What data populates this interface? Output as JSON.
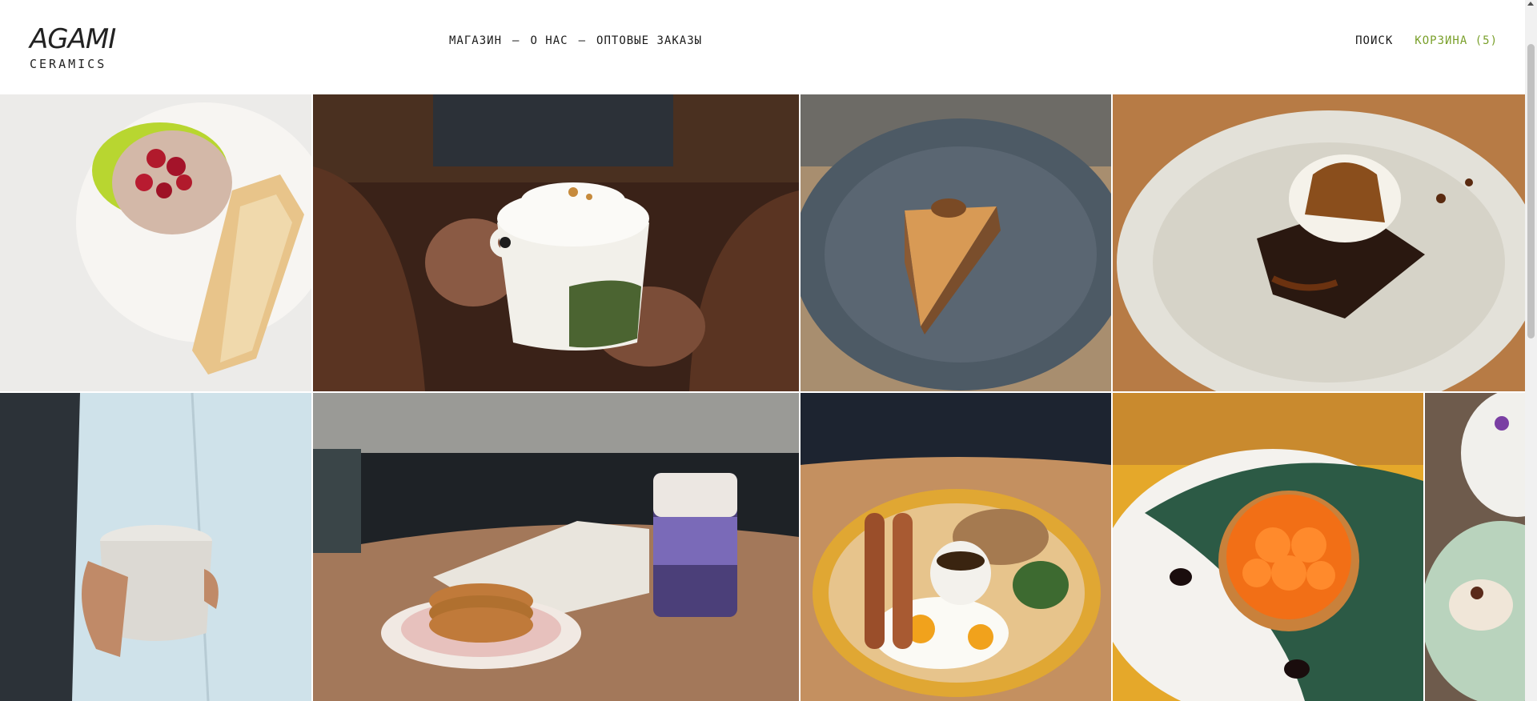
{
  "header": {
    "logo": {
      "mark": "AGAMI",
      "sub": "CERAMICS"
    },
    "nav": [
      {
        "label": "МАГАЗИН"
      },
      {
        "label": "О НАС"
      },
      {
        "label": "ОПТОВЫЕ ЗАКАЗЫ"
      }
    ],
    "separator": "—",
    "search_label": "ПОИСК",
    "cart_label": "КОРЗИНА (5)"
  },
  "gallery": {
    "tiles": [
      {
        "subject": "plate with cream dip, cherries and toast"
      },
      {
        "subject": "hands holding mug with whipped cream"
      },
      {
        "subject": "cheesecake slice with pecans on grey plate"
      },
      {
        "subject": "brownie with ice cream and caramel on white plate"
      },
      {
        "subject": "hand holding speckled cup"
      },
      {
        "subject": "cookies on pink plate with purple latte and magazine"
      },
      {
        "subject": "breakfast plate with eggs and sausages"
      },
      {
        "subject": "apricot tart on green and white plate"
      },
      {
        "subject": "dessert on mint speckled plate"
      }
    ]
  },
  "colors": {
    "accent_cart": "#7aa02b",
    "text": "#1a1a1a",
    "background": "#ffffff"
  }
}
